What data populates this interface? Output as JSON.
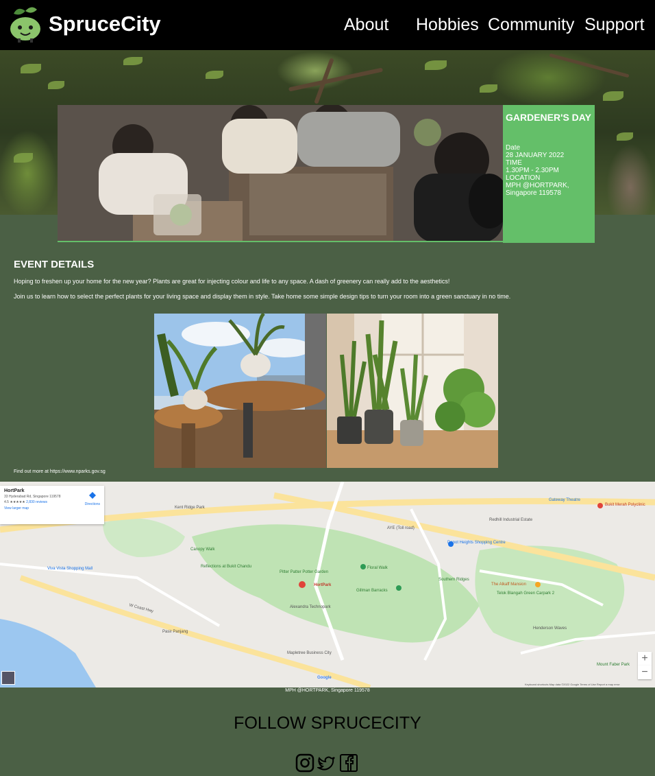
{
  "nav": {
    "brand": "SpruceCity",
    "links": [
      "About",
      "Hobbies",
      "Community",
      "Support"
    ]
  },
  "event": {
    "title": "GARDENER'S DAY",
    "date_label": "Date",
    "date": "28 JANUARY 2022",
    "time_label": "TIME",
    "time": "1.30PM - 2.30PM",
    "location_label": "LOCATION",
    "location": "MPH @HORTPARK, Singapore 119578"
  },
  "details": {
    "heading": "EVENT DETAILS",
    "paragraphs": [
      "Hoping to freshen up your home for the new year? Plants are great for injecting colour and life to any space. A dash of greenery can really add to the aesthetics!",
      "Join us to learn how to select the perfect plants for your living space and display them in style. Take home some simple design tips to turn your room into a green sanctuary in no time."
    ],
    "find_more": "Find out more at https://www.nparks.gov.sg"
  },
  "map": {
    "place_name": "HortPark",
    "address": "33 Hyderabad Rd, Singapore 119578",
    "rating": "4.5 ★★★★★",
    "reviews": "2,830 reviews",
    "directions": "Directions",
    "view_larger": "View larger map",
    "zoom_in": "+",
    "zoom_out": "−",
    "footer": "Keyboard shortcuts   Map data ©2022 Google   Terms of Use   Report a map error",
    "labels": [
      "AYE (Toll road)",
      "Kent Ridge Park",
      "HortPark",
      "Southern Ridges",
      "Alexandra Technopark",
      "Gillman Barracks",
      "Telok Blangah Green Carpark 2",
      "Henderson Waves",
      "Mount Faber Park",
      "Pasir Panjang",
      "Viva Vista Shopping Mall",
      "Canopy Walk",
      "Reflections at Bukit Chandu",
      "Pitter Patter Potter Garden",
      "Floral Walk",
      "Mapletree Business City",
      "The Alkaff Mansion",
      "Depot Heights Shopping Centre",
      "Redhill Industrial Estate",
      "Gateway Theatre",
      "Bukit Merah Polyclinic",
      "W Coast Hwy",
      "Google"
    ]
  },
  "map_caption": "MPH @HORTPARK, Singapore 119578",
  "follow": {
    "heading": "FOLLOW SPRUCECITY"
  }
}
